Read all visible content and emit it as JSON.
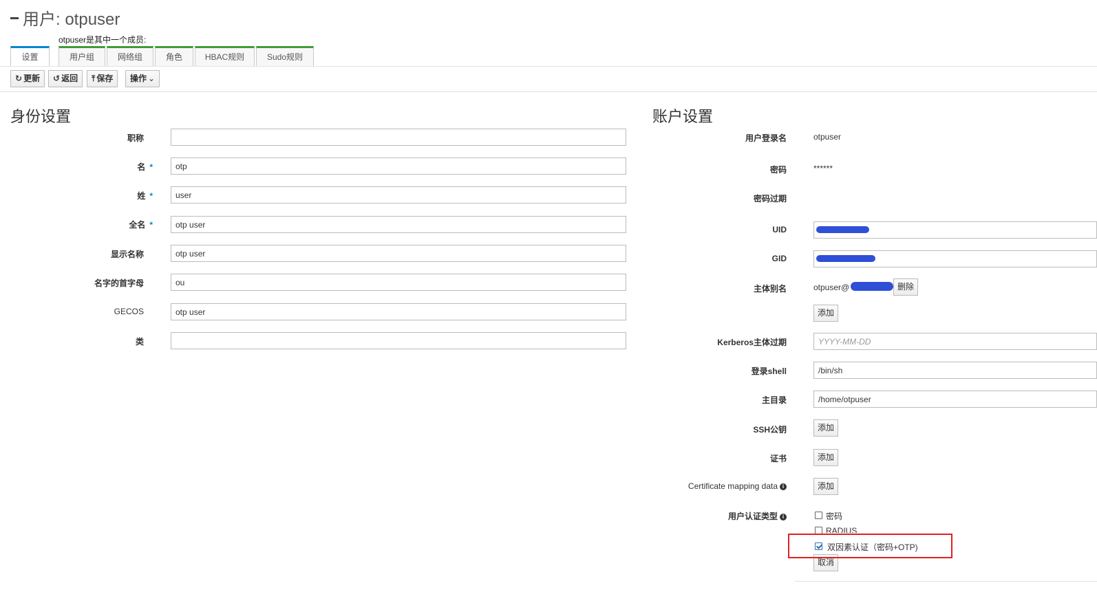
{
  "header": {
    "title": "用户: otpuser",
    "member_of": "otpuser是其中一个成员:"
  },
  "tabs": [
    {
      "label": "设置",
      "active": true
    },
    {
      "label": "用户组"
    },
    {
      "label": "网络组"
    },
    {
      "label": "角色"
    },
    {
      "label": "HBAC规则"
    },
    {
      "label": "Sudo规则"
    }
  ],
  "toolbar": {
    "refresh": "更新",
    "refresh_icon": "↻",
    "back": "返回",
    "back_icon": "↺",
    "save": "保存",
    "save_icon": "⤒",
    "actions": "操作",
    "actions_icon": "⌄"
  },
  "identity": {
    "title": "身份设置",
    "fields": [
      {
        "label": "职称",
        "value": ""
      },
      {
        "label": "名",
        "value": "otp",
        "required": true
      },
      {
        "label": "姓",
        "value": "user",
        "required": true
      },
      {
        "label": "全名",
        "value": "otp user",
        "required": true
      },
      {
        "label": "显示名称",
        "value": "otp user"
      },
      {
        "label": "名字的首字母",
        "value": "ou"
      },
      {
        "label": "GECOS",
        "value": "otp user"
      },
      {
        "label": "类",
        "value": ""
      }
    ],
    "required_mark": "*"
  },
  "account": {
    "title": "账户设置",
    "login_label": "用户登录名",
    "login_value": "otpuser",
    "password_label": "密码",
    "password_value": "******",
    "password_exp_label": "密码过期",
    "uid_label": "UID",
    "gid_label": "GID",
    "principal_label": "主体别名",
    "principal_value": "otpuser@",
    "delete_label": "删除",
    "add_label": "添加",
    "krb_exp_label": "Kerberos主体过期",
    "krb_exp_placeholder": "YYYY-MM-DD",
    "shell_label": "登录shell",
    "shell_value": "/bin/sh",
    "home_label": "主目录",
    "home_value": "/home/otpuser",
    "ssh_label": "SSH公钥",
    "cert_label": "证书",
    "certmap_label": "Certificate mapping data",
    "info_glyph": "i",
    "auth_label": "用户认证类型",
    "auth_options": [
      {
        "label": "密码",
        "checked": false
      },
      {
        "label": "RADIUS",
        "checked": false
      },
      {
        "label": "双因素认证（密码+OTP)",
        "checked": true
      }
    ],
    "cancel_label": "取消"
  },
  "colors": {
    "tab_active": "#0088ce",
    "tab_inactive": "#3f9c35",
    "required": "#0088ce",
    "highlight": "#e02020",
    "redaction": "#2f4fd6"
  }
}
